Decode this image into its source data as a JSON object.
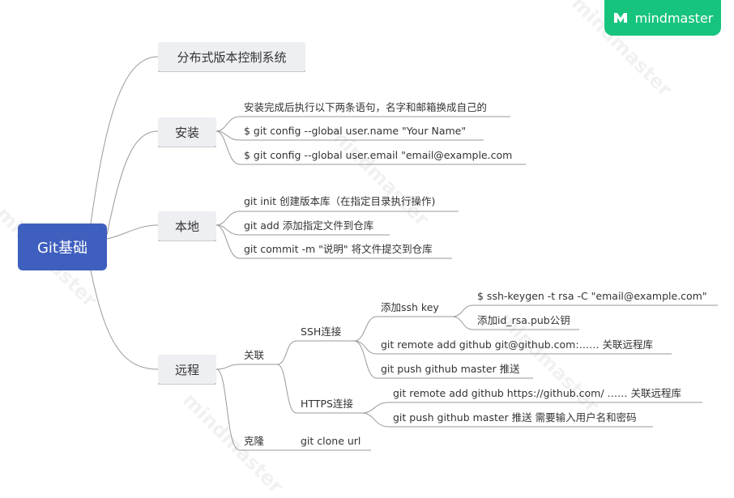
{
  "brand": {
    "logo_text": "mindmaster",
    "logo_color": "#17c47e",
    "watermark_text": "mindmaster"
  },
  "mindmap": {
    "root": "Git基础",
    "branches": {
      "distributed": "分布式版本控制系统",
      "install": {
        "label": "安装",
        "items": [
          "安装完成后执行以下两条语句，名字和邮箱换成自己的",
          "$ git config --global user.name \"Your Name\"",
          "$ git config --global user.email \"email@example.com"
        ]
      },
      "local": {
        "label": "本地",
        "items": [
          "git init 创建版本库（在指定目录执行操作)",
          "git add 添加指定文件到仓库",
          "git commit -m \"说明\" 将文件提交到仓库"
        ]
      },
      "remote": {
        "label": "远程",
        "associate": {
          "label": "关联",
          "ssh": {
            "label": "SSH连接",
            "add_key": {
              "label": "添加ssh key",
              "items": [
                "$ ssh-keygen -t rsa -C \"email@example.com\"",
                "添加id_rsa.pub公钥"
              ]
            },
            "items": [
              "git remote add github git@github.com:…… 关联远程库",
              "git push github master 推送"
            ]
          },
          "https": {
            "label": "HTTPS连接",
            "items": [
              "git remote add github https://github.com/ …… 关联远程库",
              "git push github master 推送 需要输入用户名和密码"
            ]
          }
        },
        "clone": {
          "label": "克隆",
          "item": "git clone url"
        }
      }
    }
  },
  "colors": {
    "root_bg": "#3f5fbf",
    "main_bg": "#eeeff3",
    "line": "#9a9a9a"
  }
}
